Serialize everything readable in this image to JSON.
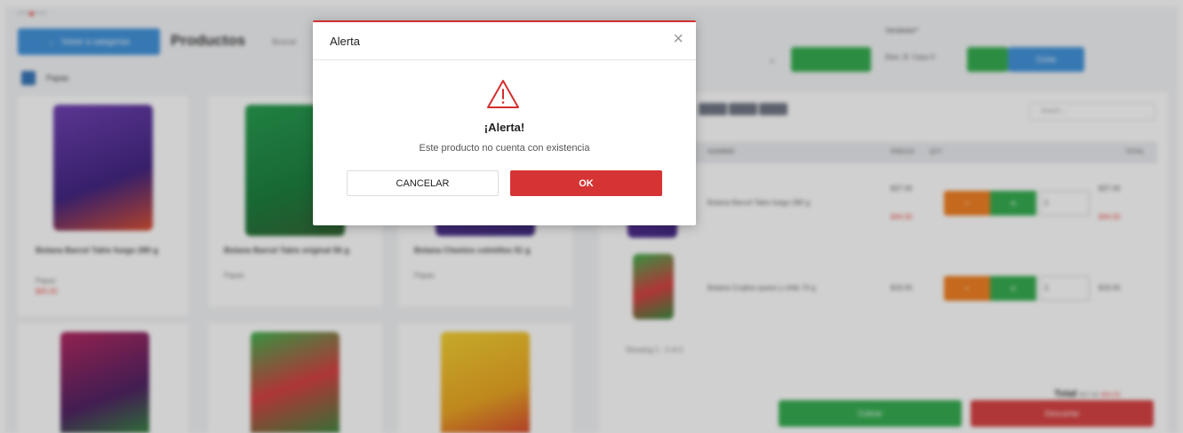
{
  "modal": {
    "title": "Alerta",
    "close_glyph": "×",
    "icon": "warning-triangle-icon",
    "heading": "¡Alerta!",
    "message": "Este producto no cuenta con existencia",
    "cancel_label": "CANCELAR",
    "ok_label": "OK",
    "accent_color": "#d32f2f"
  },
  "background": {
    "back_button_label": "Volver a categorías",
    "page_title": "Productos",
    "search_label": "Buscar",
    "category_label": "Papas",
    "products": [
      {
        "name": "Botana Barcel Takis fuego 280 g",
        "category": "Papas",
        "price": "$05.00"
      },
      {
        "name": "Botana Barcel Takis original 56 g",
        "category": "Papas"
      },
      {
        "name": "Botana Cheetos colmillos 51 g",
        "category": "Papas"
      }
    ],
    "vendor_label": "Vendedor*",
    "vendor_value": "Elen. B. Caso 0",
    "quote_button_label": "Corte",
    "search_placeholder": "Search...",
    "table_headers": [
      "NOMBRE",
      "PRECIO",
      "QTY",
      "TOTAL"
    ],
    "cart": [
      {
        "name": "Botana Barcel Takis fuego 280 g",
        "price": "$37.00",
        "old_price": "$44.00",
        "qty": "1",
        "total": "$37.00",
        "total_old": "$44.00"
      },
      {
        "name": "Botana Crujitos queso y chile 70 g",
        "price": "$19.00",
        "qty": "1",
        "total": "$19.00"
      }
    ],
    "showing_text": "Showing 1 - 2 of 2",
    "total_label": "Total",
    "total_value": "$37.00",
    "total_old": "$44.00",
    "charge_label": "Cobrar",
    "discard_label": "Descartar"
  }
}
